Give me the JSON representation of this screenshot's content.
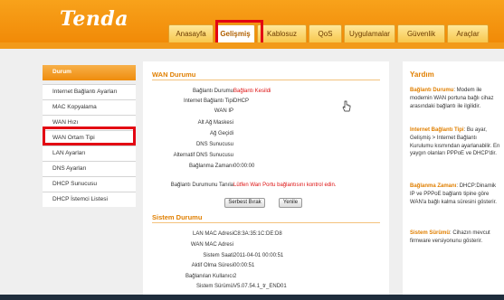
{
  "brand": {
    "logo": "Tenda"
  },
  "tabs": [
    {
      "label": "Anasayfa",
      "active": false
    },
    {
      "label": "Gelişmiş",
      "active": true
    },
    {
      "label": "Kablosuz",
      "active": false
    },
    {
      "label": "QoS",
      "active": false
    },
    {
      "label": "Uygulamalar",
      "active": false
    },
    {
      "label": "Güvenlik",
      "active": false
    },
    {
      "label": "Araçlar",
      "active": false
    }
  ],
  "sidebar": {
    "items": [
      {
        "label": "Durum",
        "active": true
      },
      {
        "label": "Internet Bağlantı Ayarları"
      },
      {
        "label": "MAC Kopyalama"
      },
      {
        "label": "WAN Hızı"
      },
      {
        "label": "WAN Ortam Tipi"
      },
      {
        "label": "LAN Ayarları"
      },
      {
        "label": "DNS Ayarları"
      },
      {
        "label": "DHCP Sunucusu"
      },
      {
        "label": "DHCP İstemci Listesi"
      }
    ]
  },
  "wan": {
    "title": "WAN Durumu",
    "rows": [
      {
        "label": "Bağlantı Durumu",
        "value": "Bağlantı Kesildi",
        "red": true
      },
      {
        "label": "Internet Bağlantı Tipi",
        "value": "DHCP"
      },
      {
        "label": "WAN IP",
        "value": ""
      },
      {
        "label": "Alt Ağ Maskesi",
        "value": ""
      },
      {
        "label": "Ağ Geçidi",
        "value": ""
      },
      {
        "label": "DNS Sunucusu",
        "value": ""
      },
      {
        "label": "Alternatif DNS Sunucusu",
        "value": ""
      },
      {
        "label": "Bağlanma Zamanı",
        "value": "00:00:00"
      }
    ],
    "diag_label": "Bağlantı Durumunu Tanıla",
    "diag_value": "Lütfen Wan Portu bağlantısını kontrol edin.",
    "release_button": "Serbest Bırak",
    "renew_button": "Yenile"
  },
  "system": {
    "title": "Sistem Durumu",
    "rows": [
      {
        "label": "LAN MAC Adresi",
        "value": "C8:3A:35:1C:DE:D8"
      },
      {
        "label": "WAN MAC Adresi",
        "value": ""
      },
      {
        "label": "Sistem Saati",
        "value": "2011-04-01 00:00:51"
      },
      {
        "label": "Aktif Olma Süresi",
        "value": "00:00:51"
      },
      {
        "label": "Bağlanılan Kullanıcı",
        "value": "2"
      },
      {
        "label": "Sistem Sürümü",
        "value": "V5.07.54.1_tr_END01"
      }
    ]
  },
  "help": {
    "title": "Yardım",
    "items": [
      {
        "term": "Bağlantı Durumu",
        "text": ": Modem ile modemin WAN portuna bağlı cihaz arasındaki bağlantı ile ilgilidir."
      },
      {
        "term": "Internet Bağlantı Tipi",
        "text": ": Bu ayar, Gelişmiş > Internet Bağlantı Kurulumu kısmından ayarlanabilir. En yaygın olanları PPPoE ve DHCP'dir."
      },
      {
        "term": "Bağlanma Zamanı",
        "text": ": DHCP:Dinamik IP ve PPPoE bağlantı tipine göre WAN'a bağlı kalma süresini gösterir."
      },
      {
        "term": "Sistem Sürümü",
        "text": ": Cihazın mevcut firmware versiyonunu gösterir."
      }
    ]
  },
  "colors": {
    "accent": "#f29a1a",
    "highlight": "#e30613",
    "section": "#e07f00",
    "error": "#dd1111"
  }
}
